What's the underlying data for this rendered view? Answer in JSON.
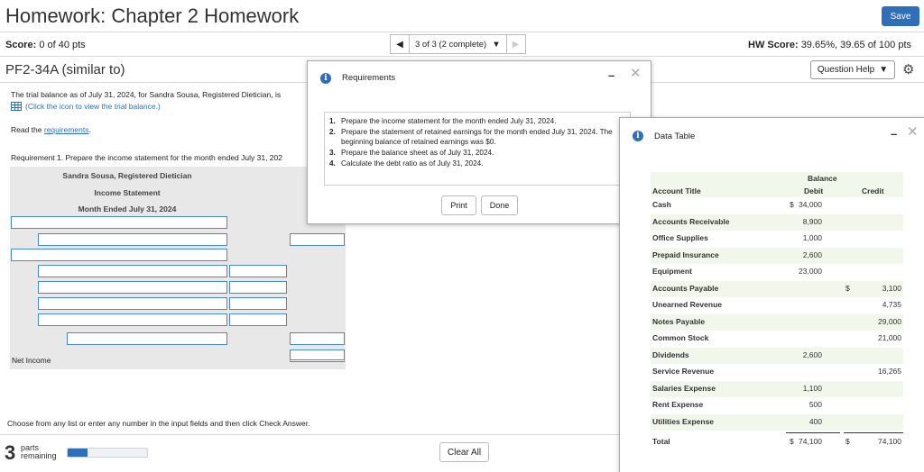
{
  "header": {
    "title": "Homework: Chapter 2 Homework",
    "save_label": "Save",
    "score_label": "Score:",
    "score_value": "0 of 40 pts",
    "nav_label": "3 of 3 (2 complete)",
    "hw_score_label": "HW Score:",
    "hw_score_value": "39.65%, 39.65 of 100 pts",
    "question_id": "PF2-34A (similar to)",
    "question_help_label": "Question Help"
  },
  "question": {
    "intro": "The trial balance as of July 31, 2024, for Sandra Sousa, Registered Dietician, is",
    "click_balance": "(Click the icon to view the trial balance.)",
    "read_prefix": "Read the ",
    "read_link": "requirements",
    "read_suffix": ".",
    "requirement_1": "Requirement 1. Prepare the income statement for the month ended July 31, 202",
    "statement_company": "Sandra Sousa, Registered Dietician",
    "statement_name": "Income Statement",
    "statement_period": "Month Ended July 31, 2024",
    "net_income_label": "Net Income",
    "choose_text": "Choose from any list or enter any number in the input fields and then click Check Answer.",
    "parts_number": "3",
    "parts_label_1": "parts",
    "parts_label_2": "remaining",
    "progress_fraction": 0.25,
    "clear_all_label": "Clear All"
  },
  "requirements_modal": {
    "title": "Requirements",
    "items": [
      {
        "num": "1.",
        "text": "Prepare the income statement for the month ended July 31, 2024."
      },
      {
        "num": "2.",
        "text": "Prepare the statement of retained earnings for the month ended July 31, 2024. The beginning balance of retained earnings was $0."
      },
      {
        "num": "3.",
        "text": "Prepare the balance sheet as of July 31, 2024."
      },
      {
        "num": "4.",
        "text": "Calculate the debt ratio as of July 31, 2024."
      }
    ],
    "print_label": "Print",
    "done_label": "Done"
  },
  "data_table_modal": {
    "title": "Data Table",
    "balance_header": "Balance",
    "account_header": "Account Title",
    "debit_header": "Debit",
    "credit_header": "Credit",
    "rows": [
      {
        "account": "Cash",
        "debit_sign": "$",
        "debit": "34,000",
        "credit_sign": "",
        "credit": ""
      },
      {
        "account": "Accounts Receivable",
        "debit_sign": "",
        "debit": "8,900",
        "credit_sign": "",
        "credit": ""
      },
      {
        "account": "Office Supplies",
        "debit_sign": "",
        "debit": "1,000",
        "credit_sign": "",
        "credit": ""
      },
      {
        "account": "Prepaid Insurance",
        "debit_sign": "",
        "debit": "2,600",
        "credit_sign": "",
        "credit": ""
      },
      {
        "account": "Equipment",
        "debit_sign": "",
        "debit": "23,000",
        "credit_sign": "",
        "credit": ""
      },
      {
        "account": "Accounts Payable",
        "debit_sign": "",
        "debit": "",
        "credit_sign": "$",
        "credit": "3,100"
      },
      {
        "account": "Unearned Revenue",
        "debit_sign": "",
        "debit": "",
        "credit_sign": "",
        "credit": "4,735"
      },
      {
        "account": "Notes Payable",
        "debit_sign": "",
        "debit": "",
        "credit_sign": "",
        "credit": "29,000"
      },
      {
        "account": "Common Stock",
        "debit_sign": "",
        "debit": "",
        "credit_sign": "",
        "credit": "21,000"
      },
      {
        "account": "Dividends",
        "debit_sign": "",
        "debit": "2,600",
        "credit_sign": "",
        "credit": ""
      },
      {
        "account": "Service Revenue",
        "debit_sign": "",
        "debit": "",
        "credit_sign": "",
        "credit": "16,265"
      },
      {
        "account": "Salaries Expense",
        "debit_sign": "",
        "debit": "1,100",
        "credit_sign": "",
        "credit": ""
      },
      {
        "account": "Rent Expense",
        "debit_sign": "",
        "debit": "500",
        "credit_sign": "",
        "credit": ""
      },
      {
        "account": "Utilities Expense",
        "debit_sign": "",
        "debit": "400",
        "credit_sign": "",
        "credit": ""
      },
      {
        "account": "Total",
        "debit_sign": "$",
        "debit": "74,100",
        "credit_sign": "$",
        "credit": "74,100"
      }
    ]
  },
  "colors": {
    "accent": "#2e6fb7",
    "input_border": "#4a89c8",
    "table_band": "#f2f7ec"
  }
}
